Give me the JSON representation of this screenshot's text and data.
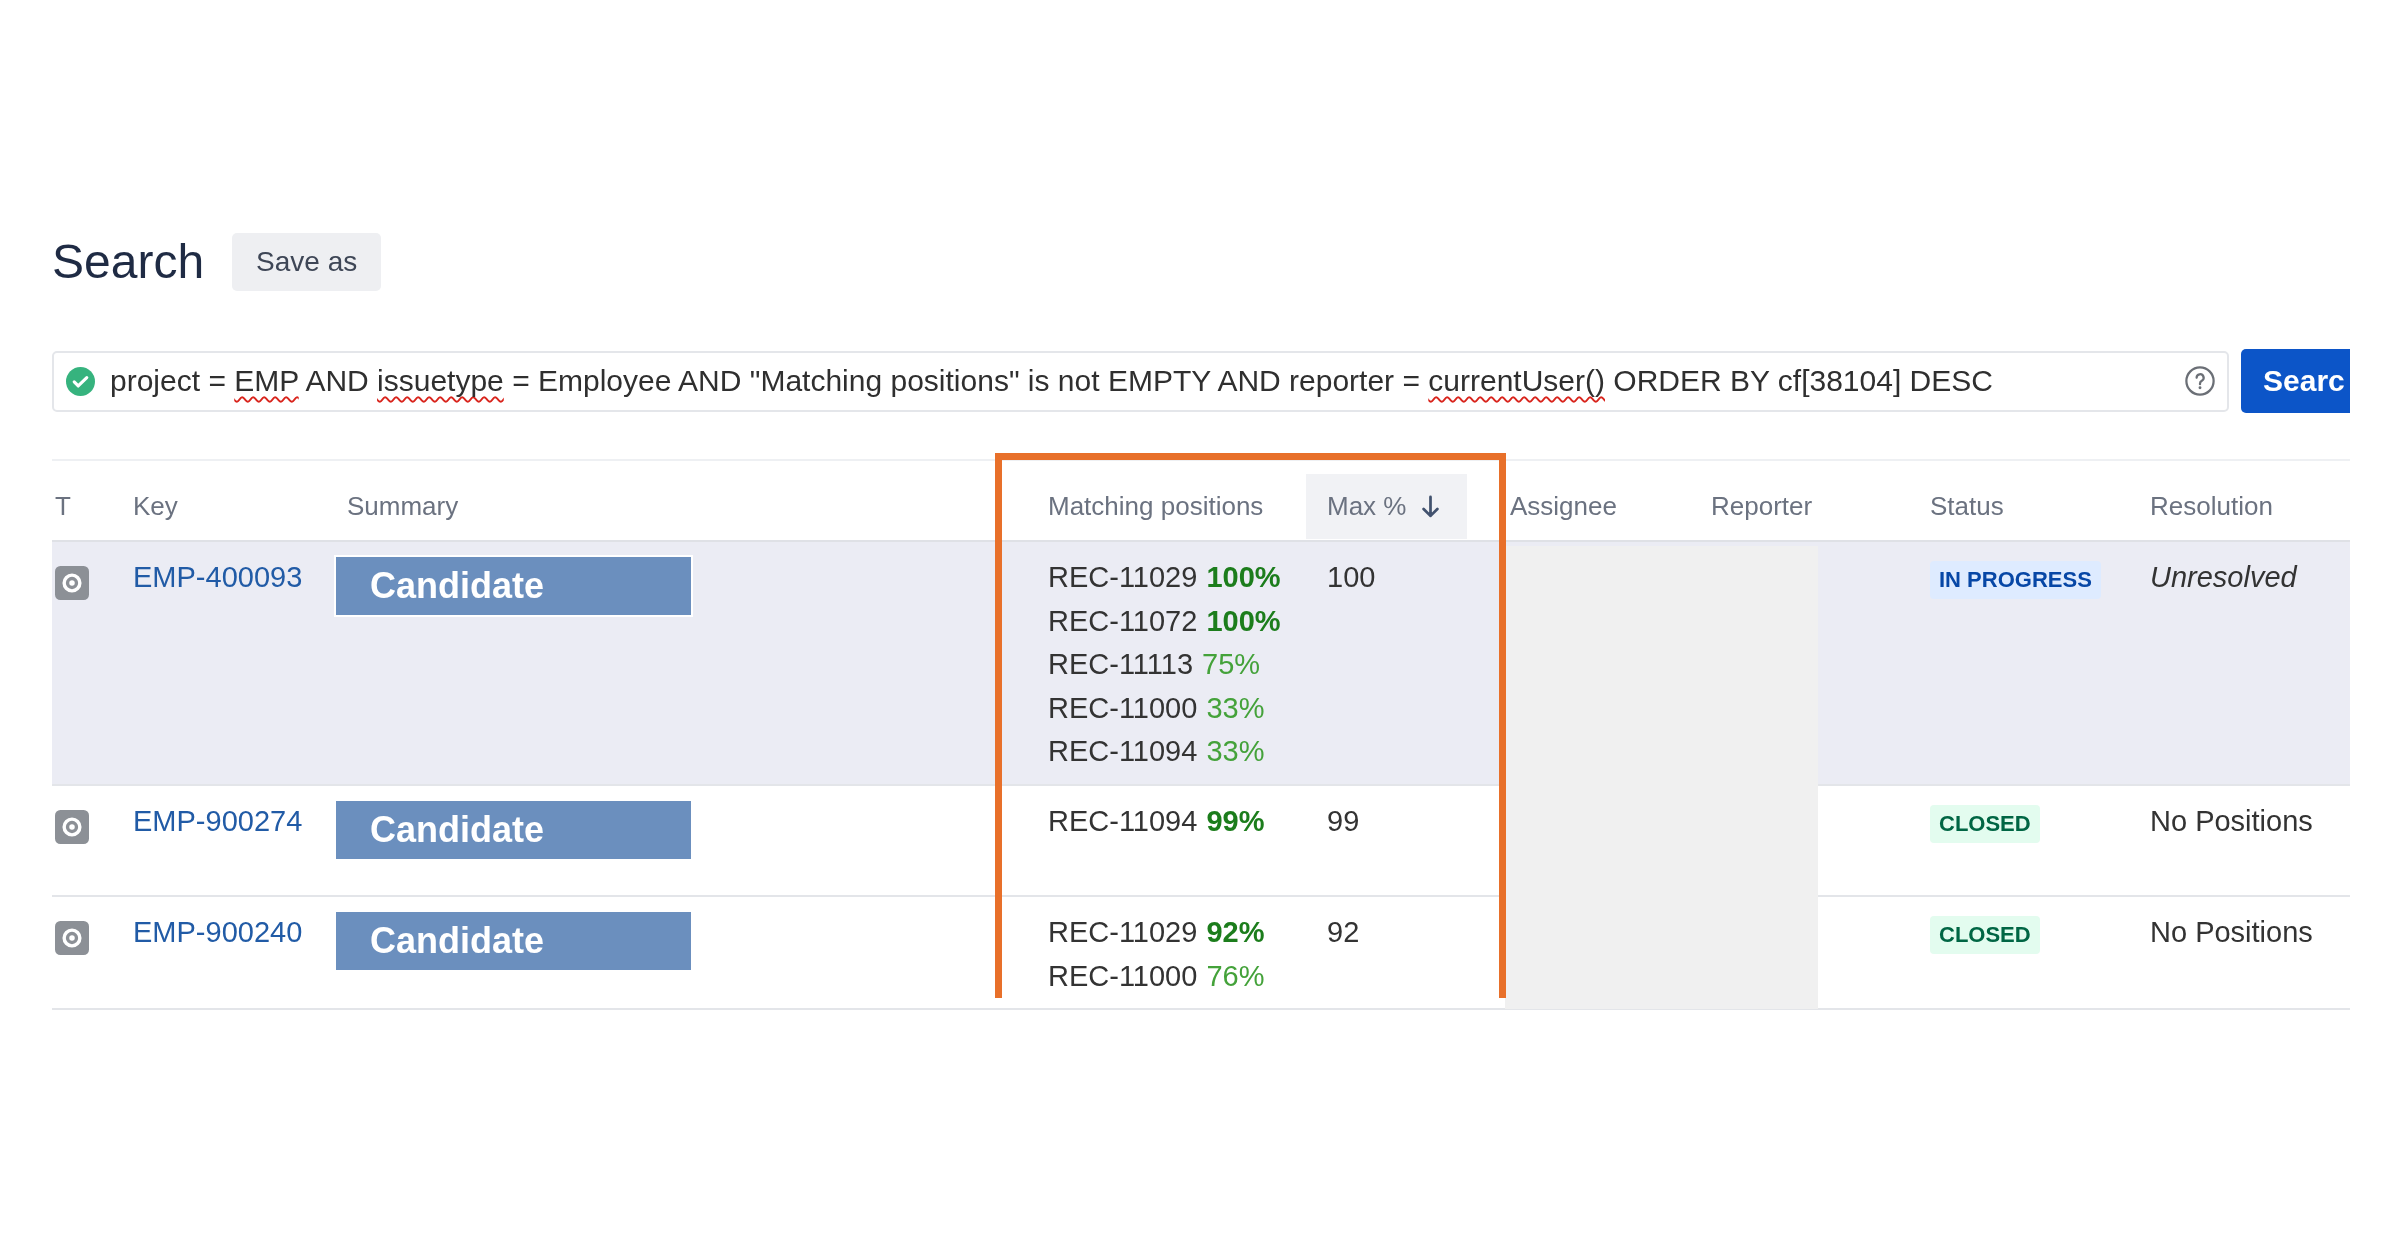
{
  "header": {
    "title": "Search",
    "save_button": "Save as"
  },
  "query": {
    "valid": true,
    "segments": [
      {
        "text": "project = ",
        "misspelled": false
      },
      {
        "text": "EMP",
        "misspelled": true
      },
      {
        "text": " AND ",
        "misspelled": false
      },
      {
        "text": "issuetype",
        "misspelled": true
      },
      {
        "text": " = Employee AND \"Matching positions\" is not EMPTY AND reporter = ",
        "misspelled": false
      },
      {
        "text": "currentUser()",
        "misspelled": true
      },
      {
        "text": " ORDER BY cf[38104] DESC",
        "misspelled": false
      }
    ]
  },
  "search_button": {
    "label": "Searc"
  },
  "table": {
    "columns": [
      {
        "label": "T",
        "sorted": false
      },
      {
        "label": "Key",
        "sorted": false
      },
      {
        "label": "Summary",
        "sorted": false
      },
      {
        "label": "Matching positions",
        "sorted": false
      },
      {
        "label": "Max %",
        "sorted": true
      },
      {
        "label": "Assignee",
        "sorted": false
      },
      {
        "label": "Reporter",
        "sorted": false
      },
      {
        "label": "Status",
        "sorted": false
      },
      {
        "label": "Resolution",
        "sorted": false
      }
    ],
    "rows": [
      {
        "selected": true,
        "key": "EMP-400093",
        "summary": "Candidate",
        "matches": [
          {
            "position": "REC-11029",
            "percent": "100%",
            "strong": true
          },
          {
            "position": "REC-11072",
            "percent": "100%",
            "strong": true
          },
          {
            "position": "REC-11113",
            "percent": "75%",
            "strong": false
          },
          {
            "position": "REC-11000",
            "percent": "33%",
            "strong": false
          },
          {
            "position": "REC-11094",
            "percent": "33%",
            "strong": false
          }
        ],
        "max": "100",
        "status": {
          "label": "IN PROGRESS",
          "kind": "progress"
        },
        "resolution": {
          "label": "Unresolved",
          "unresolved": true
        }
      },
      {
        "selected": false,
        "key": "EMP-900274",
        "summary": "Candidate",
        "matches": [
          {
            "position": "REC-11094",
            "percent": "99%",
            "strong": true
          }
        ],
        "max": "99",
        "status": {
          "label": "CLOSED",
          "kind": "done"
        },
        "resolution": {
          "label": "No Positions",
          "unresolved": false
        }
      },
      {
        "selected": false,
        "key": "EMP-900240",
        "summary": "Candidate",
        "matches": [
          {
            "position": "REC-11029",
            "percent": "92%",
            "strong": true
          },
          {
            "position": "REC-11000",
            "percent": "76%",
            "strong": false
          }
        ],
        "max": "92",
        "status": {
          "label": "CLOSED",
          "kind": "done"
        },
        "resolution": {
          "label": "No Positions",
          "unresolved": false
        }
      }
    ]
  }
}
